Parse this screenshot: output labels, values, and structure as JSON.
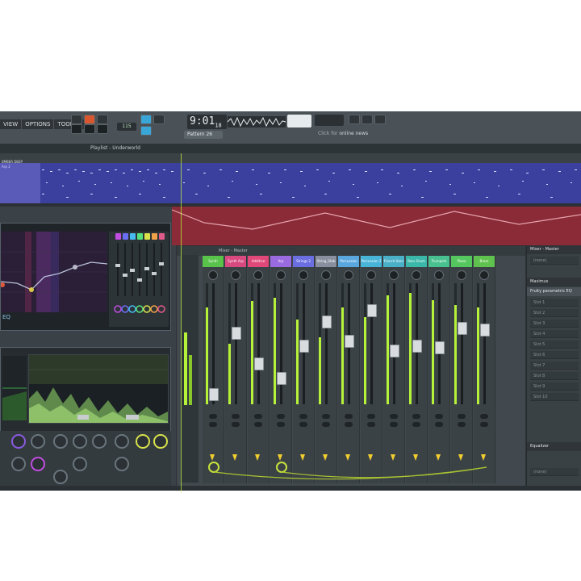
{
  "menu": [
    "VIEW",
    "OPTIONS",
    "TOOLS",
    "?"
  ],
  "transport": {
    "time": "9:01",
    "time_sub": "18",
    "bpm": "115",
    "pattern": "Pattern 26"
  },
  "news": {
    "prefix": "Click for",
    "link": "online news"
  },
  "playlist": {
    "title": "Playlist - Underworld",
    "clip_label": "Arp 2",
    "marker": "0MBER DEEP"
  },
  "eq": {
    "title": "EQ",
    "band_colors": [
      "#c04de0",
      "#6a6ef2",
      "#47b9f0",
      "#58e07b",
      "#d9e24a",
      "#f0a24a",
      "#e05a8a"
    ]
  },
  "mixer": {
    "title": "Mixer - Master",
    "channels": [
      {
        "name": "Synth",
        "color": "#58c24a"
      },
      {
        "name": "Synth Arp",
        "color": "#d84a7f"
      },
      {
        "name": "Additive",
        "color": "#e0487a"
      },
      {
        "name": "Arp",
        "color": "#9a6ae0"
      },
      {
        "name": "Strings 2",
        "color": "#6a6ee0"
      },
      {
        "name": "String_Stab",
        "color": "#8a8fa0"
      },
      {
        "name": "Percussion",
        "color": "#5aa7e0"
      },
      {
        "name": "Percussion 2",
        "color": "#48b4d8"
      },
      {
        "name": "French Horn",
        "color": "#4ab0c8"
      },
      {
        "name": "Bass Drum",
        "color": "#3ab7a9"
      },
      {
        "name": "Trumpets",
        "color": "#49c090"
      },
      {
        "name": "Piano",
        "color": "#55c75f"
      },
      {
        "name": "Brass",
        "color": "#60c24e"
      }
    ]
  },
  "panel": {
    "header": "Mixer - Master",
    "preset": "(none)",
    "title": "Fruity parametric EQ",
    "maximus": "Maximus",
    "slots": [
      "Slot 1",
      "Slot 2",
      "Slot 3",
      "Slot 4",
      "Slot 5",
      "Slot 6",
      "Slot 7",
      "Slot 8",
      "Slot 9",
      "Slot 10"
    ],
    "equalizer": "Equalizer",
    "output": "(none)"
  }
}
